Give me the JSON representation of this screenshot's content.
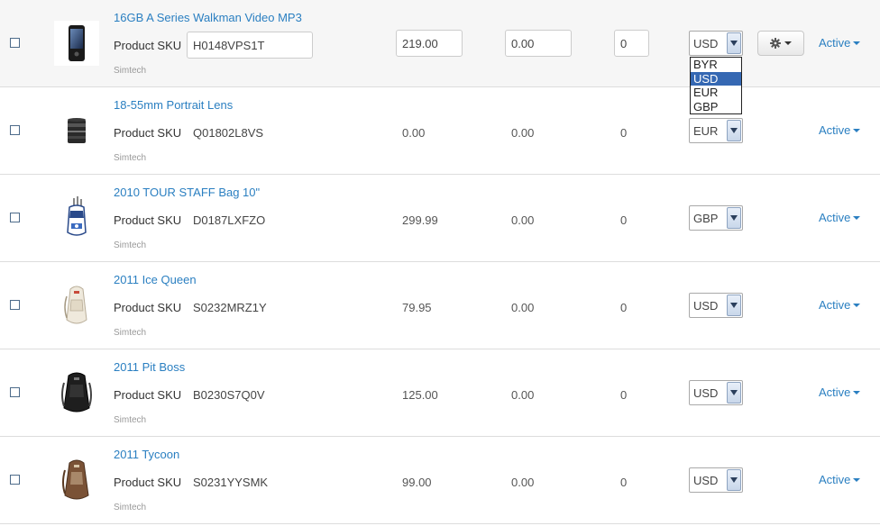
{
  "colors": {
    "link": "#2a7fc1",
    "row_border": "#dddddd",
    "hover_row": "#f6f6f6",
    "dropdown_selected": "#3568b3"
  },
  "currency_dropdown": {
    "open_on_row": 0,
    "options": [
      "BYR",
      "USD",
      "EUR",
      "GBP"
    ],
    "highlighted": "USD"
  },
  "products": [
    {
      "name": "16GB A Series Walkman Video MP3",
      "sku_label": "Product SKU",
      "sku": "H0148VPS1T",
      "vendor": "Simtech",
      "price": "219.00",
      "list_price": "0.00",
      "quantity": "0",
      "currency": "USD",
      "status": "Active",
      "image_icon": "mp3-player-image"
    },
    {
      "name": "18-55mm Portrait Lens",
      "sku_label": "Product SKU",
      "sku": "Q01802L8VS",
      "vendor": "Simtech",
      "price": "0.00",
      "list_price": "0.00",
      "quantity": "0",
      "currency": "EUR",
      "status": "Active",
      "image_icon": "camera-lens-image"
    },
    {
      "name": "2010 TOUR STAFF Bag 10\"",
      "sku_label": "Product SKU",
      "sku": "D0187LXFZO",
      "vendor": "Simtech",
      "price": "299.99",
      "list_price": "0.00",
      "quantity": "0",
      "currency": "GBP",
      "status": "Active",
      "image_icon": "golf-bag-image"
    },
    {
      "name": "2011 Ice Queen",
      "sku_label": "Product SKU",
      "sku": "S0232MRZ1Y",
      "vendor": "Simtech",
      "price": "79.95",
      "list_price": "0.00",
      "quantity": "0",
      "currency": "USD",
      "status": "Active",
      "image_icon": "white-backpack-image"
    },
    {
      "name": "2011 Pit Boss",
      "sku_label": "Product SKU",
      "sku": "B0230S7Q0V",
      "vendor": "Simtech",
      "price": "125.00",
      "list_price": "0.00",
      "quantity": "0",
      "currency": "USD",
      "status": "Active",
      "image_icon": "black-backpack-image"
    },
    {
      "name": "2011 Tycoon",
      "sku_label": "Product SKU",
      "sku": "S0231YYSMK",
      "vendor": "Simtech",
      "price": "99.00",
      "list_price": "0.00",
      "quantity": "0",
      "currency": "USD",
      "status": "Active",
      "image_icon": "brown-backpack-image"
    }
  ]
}
